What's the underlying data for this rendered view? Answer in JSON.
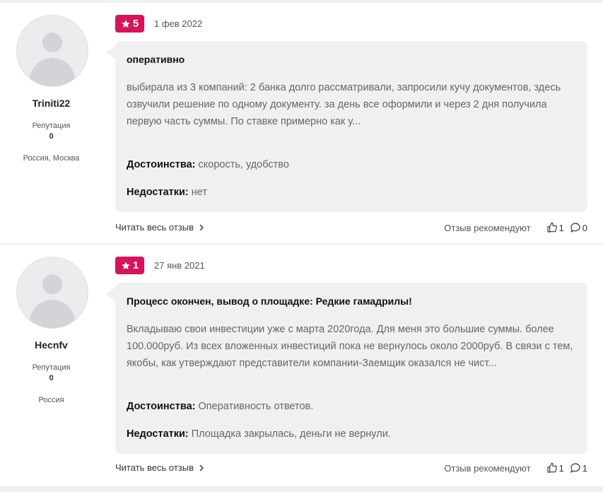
{
  "reviews": [
    {
      "author": "Triniti22",
      "reputation_label": "Репутация",
      "reputation_value": "0",
      "location": "Россия, Москва",
      "rating": "5",
      "date": "1 фев 2022",
      "title": "оперативно",
      "text": "выбирала из 3 компаний: 2 банка долго рассматривали, запросили кучу документов, здесь озвучили решение по одному документу. за день все оформили и через 2 дня получила первую часть суммы. По ставке примерно как у...",
      "pros_label": "Достоинства:",
      "pros": "скорость, удобство",
      "cons_label": "Недостатки:",
      "cons": "нет",
      "read_more": "Читать весь отзыв",
      "recommend_label": "Отзыв рекомендуют",
      "likes": "1",
      "comments": "0"
    },
    {
      "author": "Hecnfv",
      "reputation_label": "Репутация",
      "reputation_value": "0",
      "location": "Россия",
      "rating": "1",
      "date": "27 янв 2021",
      "title": "Процесс окончен, вывод о площадке: Редкие гамадрилы!",
      "text": "Вкладываю свои инвестиции уже с марта 2020года. Для меня это большие суммы. более 100.000руб. Из всех вложенных инвестиций пока не вернулось около 2000руб. В связи с тем, якобы, как утверждают представители компании-Заемщик оказался не чист...",
      "pros_label": "Достоинства:",
      "pros": "Оперативность ответов.",
      "cons_label": "Недостатки:",
      "cons": "Площадка закрылась, деньги не вернули.",
      "read_more": "Читать весь отзыв",
      "recommend_label": "Отзыв рекомендуют",
      "likes": "1",
      "comments": "1"
    }
  ],
  "colors": {
    "badge": "#d8125b",
    "bubble": "#f0f0f3",
    "background": "#f0f0f2"
  },
  "icons": {
    "rating": "star-icon",
    "like": "thumbs-up-icon",
    "comment": "comment-icon",
    "read_more": "chevron-right-icon"
  }
}
